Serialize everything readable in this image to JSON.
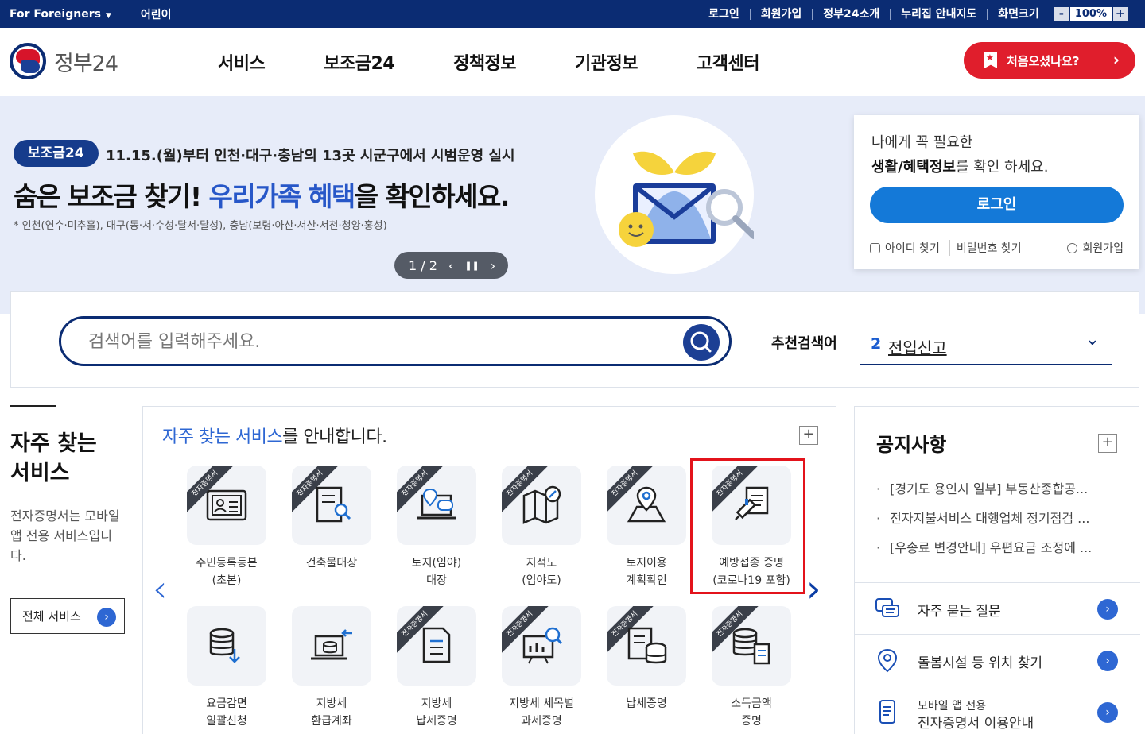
{
  "topbar": {
    "foreigners": "For Foreigners",
    "kids": "어린이",
    "links": [
      "로그인",
      "회원가입",
      "정부24소개",
      "누리집 안내지도",
      "화면크기"
    ],
    "zoom_minus": "-",
    "zoom_value": "100%",
    "zoom_plus": "+"
  },
  "header": {
    "logo_text": "정부24",
    "menu": [
      "서비스",
      "보조금24",
      "정책정보",
      "기관정보",
      "고객센터"
    ],
    "first_visit": "처음오셨나요?"
  },
  "banner": {
    "badge": "보조금24",
    "subtitle": "11.15.(월)부터 인천·대구·충남의 13곳 시군구에서 시범운영 실시",
    "title_a": "숨은 보조금 찾기! ",
    "title_hl": "우리가족 혜택",
    "title_b": "을 확인하세요.",
    "note": "* 인천(연수·미추홀), 대구(동·서·수성·달서·달성), 충남(보령·아산·서산·서천·청양·홍성)",
    "pager": "1 / 2"
  },
  "login_card": {
    "line1": "나에게 꼭 필요한",
    "line2_bold": "생활/혜택정보",
    "line2_rest": "를 확인 하세요.",
    "login_btn": "로그인",
    "find_id": "아이디 찾기",
    "find_pw": "비밀번호 찾기",
    "join": "회원가입"
  },
  "search": {
    "placeholder": "검색어를 입력해주세요.",
    "rec_label": "추천검색어",
    "rec_num": "2",
    "rec_word": "전입신고"
  },
  "left_col": {
    "title_1": "자주 찾는",
    "title_2": "서비스",
    "desc": "전자증명서는 모바일 앱 전용 서비스입니다.",
    "all_btn": "전체 서비스"
  },
  "services": {
    "title_hl": "자주 찾는 서비스",
    "title_rest": "를 안내합니다.",
    "ribbon": "전자증명서",
    "tiles": [
      {
        "l1": "주민등록등본",
        "l2": "(초본)",
        "icon": "id-card-icon"
      },
      {
        "l1": "건축물대장",
        "l2": "",
        "icon": "document-search-icon"
      },
      {
        "l1": "토지(임야)",
        "l2": "대장",
        "icon": "laptop-location-icon"
      },
      {
        "l1": "지적도",
        "l2": "(임야도)",
        "icon": "map-compass-icon"
      },
      {
        "l1": "토지이용",
        "l2": "계획확인",
        "icon": "map-pin-icon"
      },
      {
        "l1": "예방접종 증명",
        "l2": "(코로나19 포함)",
        "icon": "vaccine-icon"
      },
      {
        "l1": "요금감면",
        "l2": "일괄신청",
        "icon": "database-download-icon"
      },
      {
        "l1": "지방세",
        "l2": "환급계좌",
        "icon": "laptop-transfer-icon"
      },
      {
        "l1": "지방세",
        "l2": "납세증명",
        "icon": "tax-document-icon"
      },
      {
        "l1": "지방세 세목별",
        "l2": "과세증명",
        "icon": "chart-search-icon"
      },
      {
        "l1": "납세증명",
        "l2": "",
        "icon": "document-coins-icon"
      },
      {
        "l1": "소득금액",
        "l2": "증명",
        "icon": "coins-document-icon"
      }
    ]
  },
  "notice": {
    "title": "공지사항",
    "items": [
      "[경기도 용인시 일부] 부동산종합공...",
      "전자지불서비스 대행업체 정기점검 ...",
      "[우송료 변경안내] 우편요금 조정에 ..."
    ],
    "faq": "자주 묻는 질문",
    "facility": "돌봄시설 등 위치 찾기",
    "mobile_small": "모바일 앱 전용",
    "mobile_big": "전자증명서 이용안내"
  },
  "colors": {
    "navy": "#0b2c73",
    "accent_blue": "#2e67d3",
    "red": "#e01e2c",
    "highlight_border": "#e3131b"
  }
}
